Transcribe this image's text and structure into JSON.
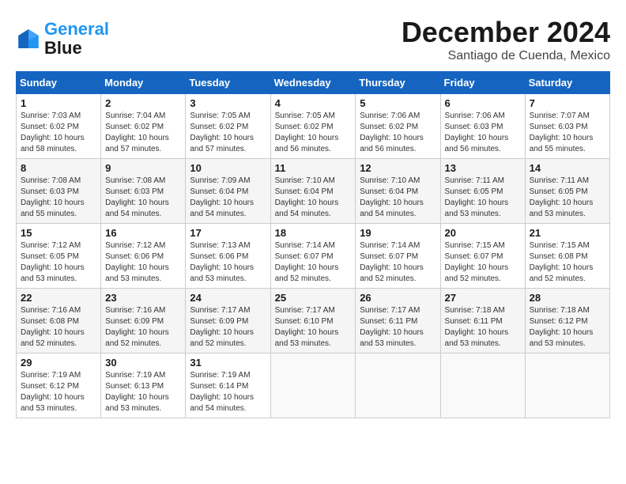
{
  "header": {
    "logo_line1": "General",
    "logo_line2": "Blue",
    "month_title": "December 2024",
    "location": "Santiago de Cuenda, Mexico"
  },
  "weekdays": [
    "Sunday",
    "Monday",
    "Tuesday",
    "Wednesday",
    "Thursday",
    "Friday",
    "Saturday"
  ],
  "weeks": [
    [
      {
        "day": "1",
        "sunrise": "7:03 AM",
        "sunset": "6:02 PM",
        "daylight": "10 hours and 58 minutes."
      },
      {
        "day": "2",
        "sunrise": "7:04 AM",
        "sunset": "6:02 PM",
        "daylight": "10 hours and 57 minutes."
      },
      {
        "day": "3",
        "sunrise": "7:05 AM",
        "sunset": "6:02 PM",
        "daylight": "10 hours and 57 minutes."
      },
      {
        "day": "4",
        "sunrise": "7:05 AM",
        "sunset": "6:02 PM",
        "daylight": "10 hours and 56 minutes."
      },
      {
        "day": "5",
        "sunrise": "7:06 AM",
        "sunset": "6:02 PM",
        "daylight": "10 hours and 56 minutes."
      },
      {
        "day": "6",
        "sunrise": "7:06 AM",
        "sunset": "6:03 PM",
        "daylight": "10 hours and 56 minutes."
      },
      {
        "day": "7",
        "sunrise": "7:07 AM",
        "sunset": "6:03 PM",
        "daylight": "10 hours and 55 minutes."
      }
    ],
    [
      {
        "day": "8",
        "sunrise": "7:08 AM",
        "sunset": "6:03 PM",
        "daylight": "10 hours and 55 minutes."
      },
      {
        "day": "9",
        "sunrise": "7:08 AM",
        "sunset": "6:03 PM",
        "daylight": "10 hours and 54 minutes."
      },
      {
        "day": "10",
        "sunrise": "7:09 AM",
        "sunset": "6:04 PM",
        "daylight": "10 hours and 54 minutes."
      },
      {
        "day": "11",
        "sunrise": "7:10 AM",
        "sunset": "6:04 PM",
        "daylight": "10 hours and 54 minutes."
      },
      {
        "day": "12",
        "sunrise": "7:10 AM",
        "sunset": "6:04 PM",
        "daylight": "10 hours and 54 minutes."
      },
      {
        "day": "13",
        "sunrise": "7:11 AM",
        "sunset": "6:05 PM",
        "daylight": "10 hours and 53 minutes."
      },
      {
        "day": "14",
        "sunrise": "7:11 AM",
        "sunset": "6:05 PM",
        "daylight": "10 hours and 53 minutes."
      }
    ],
    [
      {
        "day": "15",
        "sunrise": "7:12 AM",
        "sunset": "6:05 PM",
        "daylight": "10 hours and 53 minutes."
      },
      {
        "day": "16",
        "sunrise": "7:12 AM",
        "sunset": "6:06 PM",
        "daylight": "10 hours and 53 minutes."
      },
      {
        "day": "17",
        "sunrise": "7:13 AM",
        "sunset": "6:06 PM",
        "daylight": "10 hours and 53 minutes."
      },
      {
        "day": "18",
        "sunrise": "7:14 AM",
        "sunset": "6:07 PM",
        "daylight": "10 hours and 52 minutes."
      },
      {
        "day": "19",
        "sunrise": "7:14 AM",
        "sunset": "6:07 PM",
        "daylight": "10 hours and 52 minutes."
      },
      {
        "day": "20",
        "sunrise": "7:15 AM",
        "sunset": "6:07 PM",
        "daylight": "10 hours and 52 minutes."
      },
      {
        "day": "21",
        "sunrise": "7:15 AM",
        "sunset": "6:08 PM",
        "daylight": "10 hours and 52 minutes."
      }
    ],
    [
      {
        "day": "22",
        "sunrise": "7:16 AM",
        "sunset": "6:08 PM",
        "daylight": "10 hours and 52 minutes."
      },
      {
        "day": "23",
        "sunrise": "7:16 AM",
        "sunset": "6:09 PM",
        "daylight": "10 hours and 52 minutes."
      },
      {
        "day": "24",
        "sunrise": "7:17 AM",
        "sunset": "6:09 PM",
        "daylight": "10 hours and 52 minutes."
      },
      {
        "day": "25",
        "sunrise": "7:17 AM",
        "sunset": "6:10 PM",
        "daylight": "10 hours and 53 minutes."
      },
      {
        "day": "26",
        "sunrise": "7:17 AM",
        "sunset": "6:11 PM",
        "daylight": "10 hours and 53 minutes."
      },
      {
        "day": "27",
        "sunrise": "7:18 AM",
        "sunset": "6:11 PM",
        "daylight": "10 hours and 53 minutes."
      },
      {
        "day": "28",
        "sunrise": "7:18 AM",
        "sunset": "6:12 PM",
        "daylight": "10 hours and 53 minutes."
      }
    ],
    [
      {
        "day": "29",
        "sunrise": "7:19 AM",
        "sunset": "6:12 PM",
        "daylight": "10 hours and 53 minutes."
      },
      {
        "day": "30",
        "sunrise": "7:19 AM",
        "sunset": "6:13 PM",
        "daylight": "10 hours and 53 minutes."
      },
      {
        "day": "31",
        "sunrise": "7:19 AM",
        "sunset": "6:14 PM",
        "daylight": "10 hours and 54 minutes."
      },
      null,
      null,
      null,
      null
    ]
  ]
}
